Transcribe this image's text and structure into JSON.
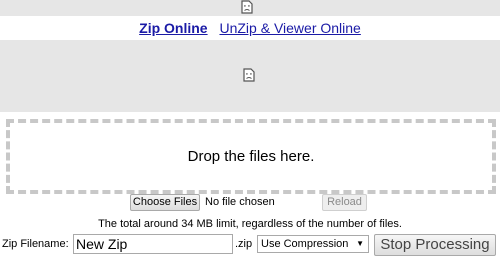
{
  "nav": {
    "active_tab": "Zip Online",
    "other_tab": "UnZip & Viewer Online"
  },
  "drop_zone": {
    "text": "Drop the files here."
  },
  "file_picker": {
    "choose_label": "Choose Files",
    "status": "No file chosen",
    "reload_label": "Reload"
  },
  "limit_note": "The total around 34 MB limit, regardless of the number of files.",
  "zip": {
    "filename_label": "Zip Filename:",
    "filename_value": "New Zip",
    "extension": ".zip",
    "compression_selected": "Use Compression",
    "stop_label": "Stop Processing"
  },
  "icons": {
    "broken_image": "broken-image-icon",
    "dropdown": "chevron-down-icon"
  },
  "colors": {
    "link": "#1a1aa6",
    "ad_background": "#e6e6e6",
    "drop_border": "#c8c8c8"
  }
}
